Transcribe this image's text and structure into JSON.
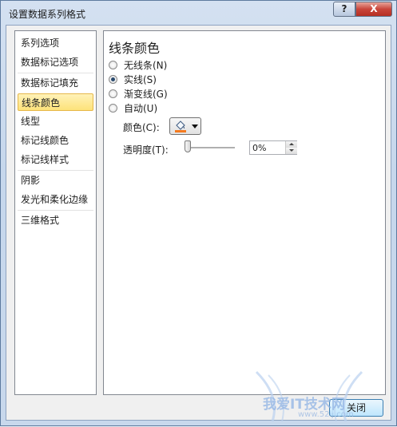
{
  "window": {
    "title": "设置数据系列格式",
    "help_glyph": "?",
    "close_glyph": "X"
  },
  "nav": {
    "items": [
      {
        "label": "系列选项"
      },
      {
        "label": "数据标记选项"
      },
      {
        "label": "数据标记填充"
      },
      {
        "label": "线条颜色",
        "selected": true
      },
      {
        "label": "线型"
      },
      {
        "label": "标记线颜色"
      },
      {
        "label": "标记线样式"
      },
      {
        "label": "阴影"
      },
      {
        "label": "发光和柔化边缘"
      },
      {
        "label": "三维格式"
      }
    ]
  },
  "panel": {
    "title": "线条颜色",
    "options": [
      {
        "label": "无线条(N)",
        "selected": false
      },
      {
        "label": "实线(S)",
        "selected": true
      },
      {
        "label": "渐变线(G)",
        "selected": false
      },
      {
        "label": "自动(U)",
        "selected": false
      }
    ],
    "color_label": "颜色(C):",
    "color_value": "#f47a1f",
    "transparency_label": "透明度(T):",
    "transparency_value": "0%",
    "transparency_level": 0
  },
  "footer": {
    "close_label": "关闭"
  },
  "watermark": {
    "text": "我爱IT技术网",
    "sub": "www.52ij.com"
  }
}
